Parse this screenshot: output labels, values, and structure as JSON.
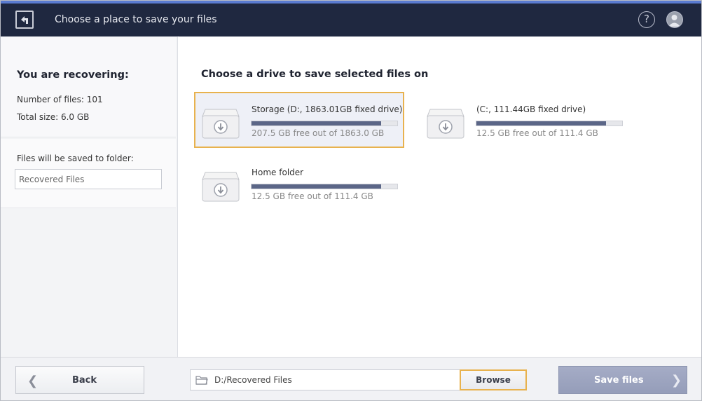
{
  "window": {
    "title": "Choose a place to save your files",
    "help_label": "?",
    "icons": {
      "logo": "app-logo-icon",
      "help": "help-icon",
      "account": "account-icon"
    }
  },
  "sidebar": {
    "heading": "You are recovering:",
    "files_count": "Number of files: 101",
    "total_size": "Total size: 6.0 GB",
    "folder_label": "Files will be saved to folder:",
    "folder_value": "Recovered Files"
  },
  "main": {
    "heading": "Choose a drive to save selected files on",
    "drives": [
      {
        "name": "Storage (D:, 1863.01GB fixed drive)",
        "free": "207.5 GB free out of 1863.0 GB",
        "used_fraction": 0.89,
        "selected": true
      },
      {
        "name": "(C:, 111.44GB fixed drive)",
        "free": "12.5 GB free out of 111.4 GB",
        "used_fraction": 0.89,
        "selected": false
      },
      {
        "name": "Home folder",
        "free": "12.5 GB free out of 111.4 GB",
        "used_fraction": 0.89,
        "selected": false
      }
    ]
  },
  "footer": {
    "back_label": "Back",
    "path_value": "D:/Recovered Files",
    "browse_label": "Browse",
    "save_label": "Save files"
  },
  "colors": {
    "titlebar": "#1f2840",
    "accent_border": "#e8b24e",
    "bar_fill": "#5b6687",
    "save_button": "#9ea6c0"
  }
}
